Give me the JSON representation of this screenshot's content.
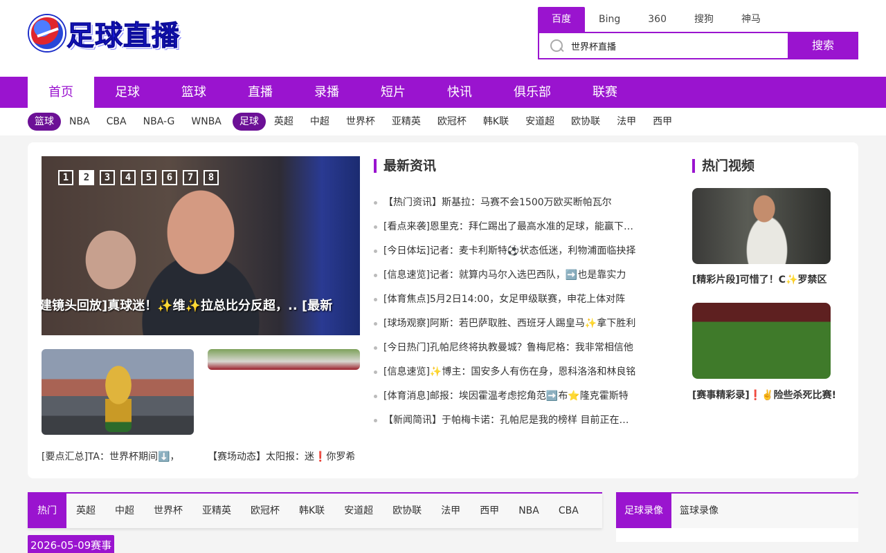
{
  "logo": {
    "text": "足球直播"
  },
  "search": {
    "engines": [
      "百度",
      "Bing",
      "360",
      "搜狗",
      "神马"
    ],
    "active_engine": 0,
    "query": "世界杯直播",
    "button_label": "搜索"
  },
  "main_nav": [
    "首页",
    "足球",
    "篮球",
    "直播",
    "录播",
    "短片",
    "快讯",
    "俱乐部",
    "联赛"
  ],
  "sub_nav": {
    "basketball_label": "篮球",
    "basketball_items": [
      "NBA",
      "CBA",
      "NBA-G",
      "WNBA"
    ],
    "football_label": "足球",
    "football_items": [
      "英超",
      "中超",
      "世界杯",
      "亚精英",
      "欧冠杯",
      "韩K联",
      "安道超",
      "欧协联",
      "法甲",
      "西甲"
    ]
  },
  "slider": {
    "dots": [
      "1",
      "2",
      "3",
      "4",
      "5",
      "6",
      "7",
      "8"
    ],
    "active_dot": 1,
    "caption": "建镜头回放]真球迷！✨维✨拉总比分反超，.. [最新"
  },
  "thumbs": [
    {
      "caption": "[要点汇总]TA：世界杯期间⬇️，"
    },
    {
      "caption": "【赛场动态】太阳报：迷❗你罗希"
    }
  ],
  "latest_news": {
    "title": "最新资讯",
    "items": [
      "【热门资讯】斯基拉：马赛不会1500万欧买断帕瓦尔",
      "[看点来袭]恩里克：拜仁踢出了最高水准的足球，能赢下比赛",
      "[今日体坛]记者：麦卡利斯特⚽状态低迷，利物浦面临抉择",
      "[信息速览]记者：就算内马尔入选巴西队，➡️也是靠实力",
      "[体育焦点]5月2日14:00，女足甲级联赛，申花上体对阵",
      "[球场观察]阿斯：若巴萨取胜、西班牙人踢皇马✨拿下胜利",
      "[今日热门]孔帕尼终将执教曼城？鲁梅尼格：我非常相信他",
      "[信息速览]✨博主：国安多人有伤在身，恩科洛洛和林良铭",
      "[体育消息]邮报：埃因霍温考虑挖角范➡️布⭐隆克霍斯特",
      "【新闻简讯】于帕梅卡诺：孔帕尼是我的榜样 目前正在学习"
    ]
  },
  "hot_videos": {
    "title": "热门视频",
    "items": [
      {
        "caption": "[精彩片段]可惜了！C✨罗禁区"
      },
      {
        "caption": "[赛事精彩录]❗✌️险些杀死比赛!"
      }
    ]
  },
  "match_tabs": [
    "热门",
    "英超",
    "中超",
    "世界杯",
    "亚精英",
    "欧冠杯",
    "韩K联",
    "安道超",
    "欧协联",
    "法甲",
    "西甲",
    "NBA",
    "CBA"
  ],
  "replay_tabs": [
    "足球录像",
    "篮球录像"
  ],
  "date_badge": "2026-05-09赛事",
  "colors": {
    "accent": "#9a14cf",
    "pill": "#6c1096",
    "logo_blue": "#1c1ce0"
  }
}
